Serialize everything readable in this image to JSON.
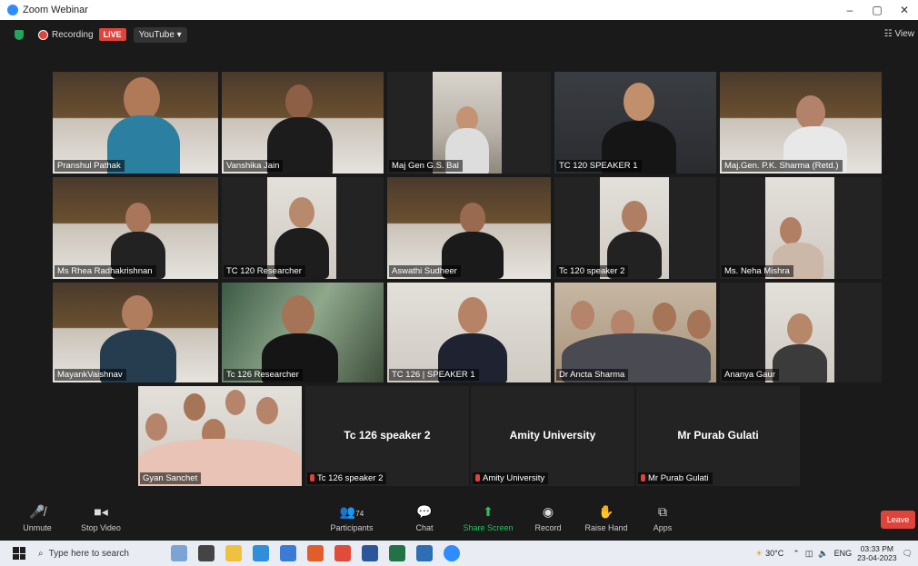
{
  "window": {
    "title": "Zoom Webinar",
    "min": "–",
    "max": "▢",
    "close": "✕"
  },
  "topbar": {
    "recording_label": "Recording",
    "live_label": "LIVE",
    "stream_label": "YouTube ▾",
    "view_label": "☷ View"
  },
  "participants_tiles": [
    "Pranshul Pathak",
    "Vanshika Jain",
    "Maj Gen G.S. Bal",
    "TC 120 SPEAKER 1",
    "Maj.Gen. P.K. Sharma (Retd.)",
    "Ms Rhea Radhakrishnan",
    "TC 120 Researcher",
    "Aswathi Sudheer",
    "Tc 120 speaker 2",
    "Ms. Neha Mishra",
    "MayankVaishnav",
    "Tc 126 Researcher",
    "TC 126 | SPEAKER 1",
    "Dr Ancta Sharma",
    "Ananya Gaur",
    "Gyan Sanchet",
    "Tc 126 speaker 2",
    "Amity University",
    "Mr Purab Gulati"
  ],
  "center_names": {
    "t17": "Tc 126 speaker 2",
    "t18": "Amity University",
    "t19": "Mr Purab Gulati"
  },
  "controls": {
    "unmute": "Unmute",
    "stop_video": "Stop Video",
    "participants": "Participants",
    "participants_count": "74",
    "chat": "Chat",
    "share_screen": "Share Screen",
    "record": "Record",
    "raise_hand": "Raise Hand",
    "apps": "Apps",
    "leave": "Leave"
  },
  "taskbar": {
    "search_placeholder": "Type here to search",
    "temperature": "30°C",
    "language": "ENG",
    "time": "03:33 PM",
    "date": "23-04-2023"
  },
  "colors": {
    "accent_live": "#e0433a",
    "share_green": "#23c25a",
    "active_speaker": "#c6e84a",
    "zoom_blue": "#2d8cff"
  }
}
